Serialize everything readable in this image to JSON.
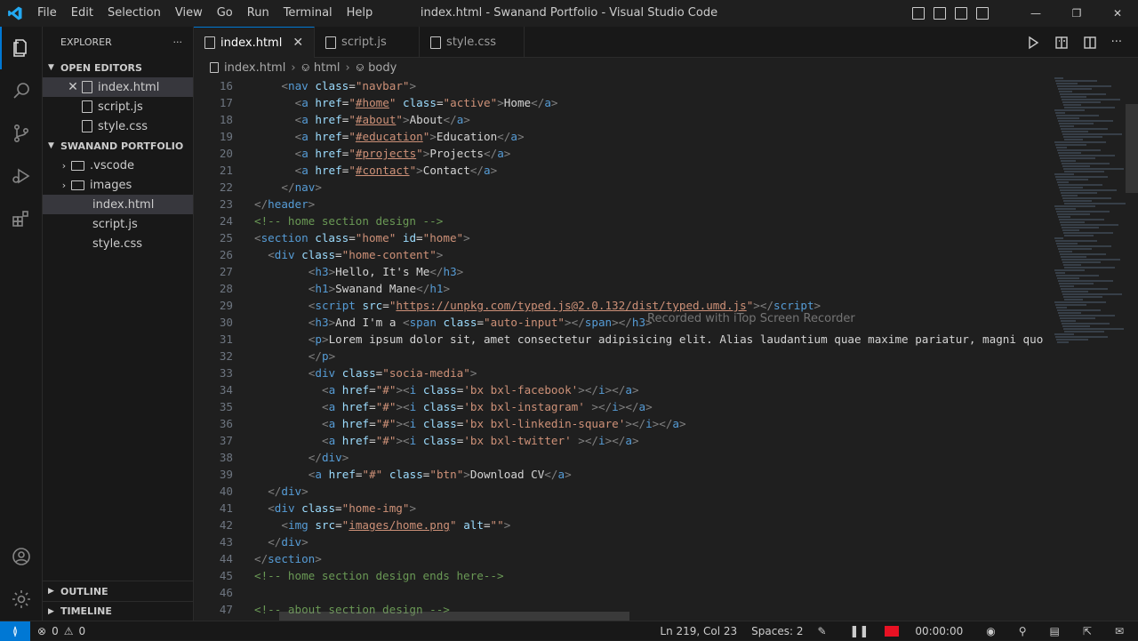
{
  "title_bar": {
    "menus": [
      "File",
      "Edit",
      "Selection",
      "View",
      "Go",
      "Run",
      "Terminal",
      "Help"
    ],
    "window_title": "index.html - Swanand Portfolio - Visual Studio Code"
  },
  "sidebar": {
    "header": "EXPLORER",
    "open_editors_title": "OPEN EDITORS",
    "open_editors": [
      "index.html",
      "script.js",
      "style.css"
    ],
    "project_title": "SWANAND PORTFOLIO",
    "folders": [
      ".vscode",
      "images"
    ],
    "files": [
      "index.html",
      "script.js",
      "style.css"
    ],
    "outline_title": "OUTLINE",
    "timeline_title": "TIMELINE"
  },
  "tabs": [
    {
      "label": "index.html"
    },
    {
      "label": "script.js"
    },
    {
      "label": "style.css"
    }
  ],
  "breadcrumbs": [
    "index.html",
    "html",
    "body"
  ],
  "watermark": "Recorded with iTop Screen Recorder",
  "status": {
    "problems": "0",
    "warnings": "0",
    "position": "Ln 219, Col 23",
    "spaces": "Spaces: 2",
    "timer": "00:00:00"
  },
  "code_lines": [
    {
      "n": "16",
      "i": 4,
      "h": "<span class='g'>&lt;</span><span class='t'>nav</span> <span class='a'>class</span><span class='p'>=</span><span class='s'>\"navbar\"</span><span class='g'>&gt;</span>"
    },
    {
      "n": "17",
      "i": 6,
      "h": "<span class='g'>&lt;</span><span class='t'>a</span> <span class='a'>href</span><span class='p'>=</span><span class='s'>\"</span><span class='u'>#home</span><span class='s'>\"</span> <span class='a'>class</span><span class='p'>=</span><span class='s'>\"active\"</span><span class='g'>&gt;</span><span class='p'>Home</span><span class='g'>&lt;/</span><span class='t'>a</span><span class='g'>&gt;</span>"
    },
    {
      "n": "18",
      "i": 6,
      "h": "<span class='g'>&lt;</span><span class='t'>a</span> <span class='a'>href</span><span class='p'>=</span><span class='s'>\"</span><span class='u'>#about</span><span class='s'>\"</span><span class='g'>&gt;</span><span class='p'>About</span><span class='g'>&lt;/</span><span class='t'>a</span><span class='g'>&gt;</span>"
    },
    {
      "n": "19",
      "i": 6,
      "h": "<span class='g'>&lt;</span><span class='t'>a</span> <span class='a'>href</span><span class='p'>=</span><span class='s'>\"</span><span class='u'>#education</span><span class='s'>\"</span><span class='g'>&gt;</span><span class='p'>Education</span><span class='g'>&lt;/</span><span class='t'>a</span><span class='g'>&gt;</span>"
    },
    {
      "n": "20",
      "i": 6,
      "h": "<span class='g'>&lt;</span><span class='t'>a</span> <span class='a'>href</span><span class='p'>=</span><span class='s'>\"</span><span class='u'>#projects</span><span class='s'>\"</span><span class='g'>&gt;</span><span class='p'>Projects</span><span class='g'>&lt;/</span><span class='t'>a</span><span class='g'>&gt;</span>"
    },
    {
      "n": "21",
      "i": 6,
      "h": "<span class='g'>&lt;</span><span class='t'>a</span> <span class='a'>href</span><span class='p'>=</span><span class='s'>\"</span><span class='u'>#contact</span><span class='s'>\"</span><span class='g'>&gt;</span><span class='p'>Contact</span><span class='g'>&lt;/</span><span class='t'>a</span><span class='g'>&gt;</span>"
    },
    {
      "n": "22",
      "i": 4,
      "h": "<span class='g'>&lt;/</span><span class='t'>nav</span><span class='g'>&gt;</span>"
    },
    {
      "n": "23",
      "i": 0,
      "h": "<span class='g'>&lt;/</span><span class='t'>header</span><span class='g'>&gt;</span>"
    },
    {
      "n": "24",
      "i": 0,
      "h": "<span class='c'>&lt;!-- home section design --&gt;</span>"
    },
    {
      "n": "25",
      "i": 0,
      "h": "<span class='g'>&lt;</span><span class='t'>section</span> <span class='a'>class</span><span class='p'>=</span><span class='s'>\"home\"</span> <span class='a'>id</span><span class='p'>=</span><span class='s'>\"home\"</span><span class='g'>&gt;</span>"
    },
    {
      "n": "26",
      "i": 2,
      "h": "<span class='g'>&lt;</span><span class='t'>div</span> <span class='a'>class</span><span class='p'>=</span><span class='s'>\"home-content\"</span><span class='g'>&gt;</span>"
    },
    {
      "n": "27",
      "i": 8,
      "h": "<span class='g'>&lt;</span><span class='t'>h3</span><span class='g'>&gt;</span><span class='p'>Hello, It's Me</span><span class='g'>&lt;/</span><span class='t'>h3</span><span class='g'>&gt;</span>"
    },
    {
      "n": "28",
      "i": 8,
      "h": "<span class='g'>&lt;</span><span class='t'>h1</span><span class='g'>&gt;</span><span class='p'>Swanand Mane</span><span class='g'>&lt;/</span><span class='t'>h1</span><span class='g'>&gt;</span>"
    },
    {
      "n": "29",
      "i": 8,
      "h": "<span class='g'>&lt;</span><span class='t'>script</span> <span class='a'>src</span><span class='p'>=</span><span class='s'>\"</span><span class='u'>https://unpkg.com/typed.js@2.0.132/dist/typed.umd.js</span><span class='s'>\"</span><span class='g'>&gt;&lt;/</span><span class='t'>script</span><span class='g'>&gt;</span>"
    },
    {
      "n": "30",
      "i": 8,
      "h": "<span class='g'>&lt;</span><span class='t'>h3</span><span class='g'>&gt;</span><span class='p'>And I'm a </span><span class='g'>&lt;</span><span class='t'>span</span> <span class='a'>class</span><span class='p'>=</span><span class='s'>\"auto-input\"</span><span class='g'>&gt;&lt;/</span><span class='t'>span</span><span class='g'>&gt;&lt;/</span><span class='t'>h3</span><span class='g'>&gt;</span>"
    },
    {
      "n": "31",
      "i": 8,
      "h": "<span class='g'>&lt;</span><span class='t'>p</span><span class='g'>&gt;</span><span class='p'>Lorem ipsum dolor sit, amet consectetur adipisicing elit. Alias laudantium quae maxime pariatur, magni quo</span>"
    },
    {
      "n": "32",
      "i": 8,
      "h": "<span class='g'>&lt;/</span><span class='t'>p</span><span class='g'>&gt;</span>"
    },
    {
      "n": "33",
      "i": 8,
      "h": "<span class='g'>&lt;</span><span class='t'>div</span> <span class='a'>class</span><span class='p'>=</span><span class='s'>\"socia-media\"</span><span class='g'>&gt;</span>"
    },
    {
      "n": "34",
      "i": 10,
      "h": "<span class='g'>&lt;</span><span class='t'>a</span> <span class='a'>href</span><span class='p'>=</span><span class='s'>\"#\"</span><span class='g'>&gt;&lt;</span><span class='t'>i</span> <span class='a'>class</span><span class='p'>=</span><span class='s'>'bx bxl-facebook'</span><span class='g'>&gt;&lt;/</span><span class='t'>i</span><span class='g'>&gt;&lt;/</span><span class='t'>a</span><span class='g'>&gt;</span>"
    },
    {
      "n": "35",
      "i": 10,
      "h": "<span class='g'>&lt;</span><span class='t'>a</span> <span class='a'>href</span><span class='p'>=</span><span class='s'>\"#\"</span><span class='g'>&gt;&lt;</span><span class='t'>i</span> <span class='a'>class</span><span class='p'>=</span><span class='s'>'bx bxl-instagram'</span> <span class='g'>&gt;&lt;/</span><span class='t'>i</span><span class='g'>&gt;&lt;/</span><span class='t'>a</span><span class='g'>&gt;</span>"
    },
    {
      "n": "36",
      "i": 10,
      "h": "<span class='g'>&lt;</span><span class='t'>a</span> <span class='a'>href</span><span class='p'>=</span><span class='s'>\"#\"</span><span class='g'>&gt;&lt;</span><span class='t'>i</span> <span class='a'>class</span><span class='p'>=</span><span class='s'>'bx bxl-linkedin-square'</span><span class='g'>&gt;&lt;/</span><span class='t'>i</span><span class='g'>&gt;&lt;/</span><span class='t'>a</span><span class='g'>&gt;</span>"
    },
    {
      "n": "37",
      "i": 10,
      "h": "<span class='g'>&lt;</span><span class='t'>a</span> <span class='a'>href</span><span class='p'>=</span><span class='s'>\"#\"</span><span class='g'>&gt;&lt;</span><span class='t'>i</span> <span class='a'>class</span><span class='p'>=</span><span class='s'>'bx bxl-twitter'</span> <span class='g'>&gt;&lt;/</span><span class='t'>i</span><span class='g'>&gt;&lt;/</span><span class='t'>a</span><span class='g'>&gt;</span>"
    },
    {
      "n": "38",
      "i": 8,
      "h": "<span class='g'>&lt;/</span><span class='t'>div</span><span class='g'>&gt;</span>"
    },
    {
      "n": "39",
      "i": 8,
      "h": "<span class='g'>&lt;</span><span class='t'>a</span> <span class='a'>href</span><span class='p'>=</span><span class='s'>\"#\"</span> <span class='a'>class</span><span class='p'>=</span><span class='s'>\"btn\"</span><span class='g'>&gt;</span><span class='p'>Download CV</span><span class='g'>&lt;/</span><span class='t'>a</span><span class='g'>&gt;</span>"
    },
    {
      "n": "40",
      "i": 2,
      "h": "<span class='g'>&lt;/</span><span class='t'>div</span><span class='g'>&gt;</span>"
    },
    {
      "n": "41",
      "i": 2,
      "h": "<span class='g'>&lt;</span><span class='t'>div</span> <span class='a'>class</span><span class='p'>=</span><span class='s'>\"home-img\"</span><span class='g'>&gt;</span>"
    },
    {
      "n": "42",
      "i": 4,
      "h": "<span class='g'>&lt;</span><span class='t'>img</span> <span class='a'>src</span><span class='p'>=</span><span class='s'>\"</span><span class='u'>images/home.png</span><span class='s'>\"</span> <span class='a'>alt</span><span class='p'>=</span><span class='s'>\"\"</span><span class='g'>&gt;</span>"
    },
    {
      "n": "43",
      "i": 2,
      "h": "<span class='g'>&lt;/</span><span class='t'>div</span><span class='g'>&gt;</span>"
    },
    {
      "n": "44",
      "i": 0,
      "h": "<span class='g'>&lt;/</span><span class='t'>section</span><span class='g'>&gt;</span>"
    },
    {
      "n": "45",
      "i": 0,
      "h": "<span class='c'>&lt;!-- home section design ends here--&gt;</span>"
    },
    {
      "n": "46",
      "i": 0,
      "h": ""
    },
    {
      "n": "47",
      "i": 0,
      "h": "<span class='c'>&lt;!-- about section design --&gt;</span>"
    }
  ]
}
